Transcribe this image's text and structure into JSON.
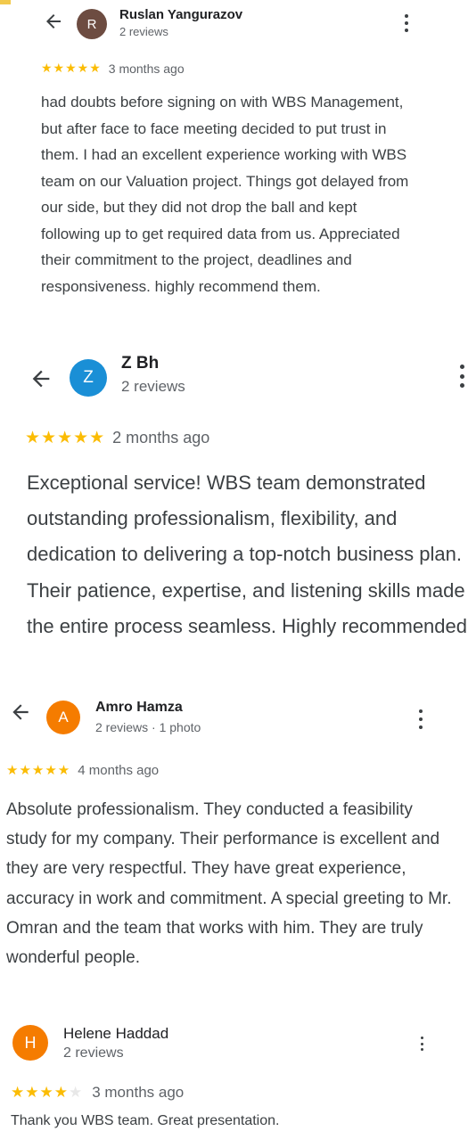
{
  "colors": {
    "star": "#fbbc04",
    "avatar_r": "#6d4c41",
    "avatar_z": "#1a8fd6",
    "avatar_a": "#f57c00",
    "avatar_h": "#f57c00"
  },
  "icons": {
    "back": "arrow-left-icon",
    "more": "more-vert-icon",
    "star": "star-icon"
  },
  "reviews": [
    {
      "initial": "R",
      "name": "Ruslan Yangurazov",
      "meta": "2 reviews",
      "stars": "★★★★★",
      "rating": 5,
      "time": "3 months ago",
      "text": "had doubts before signing on with WBS Management, but after face to face meeting decided to put trust in them. I had an excellent experience working with WBS team on our Valuation project. Things got delayed from our side, but they did not drop the ball and kept following up to get required data from us. Appreciated their commitment to the project, deadlines and responsiveness. highly recommend them."
    },
    {
      "initial": "Z",
      "name": "Z Bh",
      "meta": "2 reviews",
      "stars": "★★★★★",
      "rating": 5,
      "time": "2 months ago",
      "text": "Exceptional service! WBS team demonstrated outstanding professionalism, flexibility, and dedication to delivering a top-notch business plan. Their patience, expertise, and listening skills made the entire process seamless. Highly recommended"
    },
    {
      "initial": "A",
      "name": "Amro Hamza",
      "meta": "2 reviews · 1 photo",
      "stars": "★★★★★",
      "rating": 5,
      "time": "4 months ago",
      "text": "Absolute professionalism. They conducted a feasibility study for my company. Their performance is excellent and they are very respectful. They have great experience, accuracy in work and commitment. A special greeting to Mr. Omran and the team that works with him. They are truly wonderful people."
    },
    {
      "initial": "H",
      "name": "Helene Haddad",
      "meta": "2 reviews",
      "stars": "★★★★",
      "stars_empty": "★",
      "rating": 4,
      "time": "3 months ago",
      "text": "Thank you WBS team. Great presentation."
    }
  ]
}
